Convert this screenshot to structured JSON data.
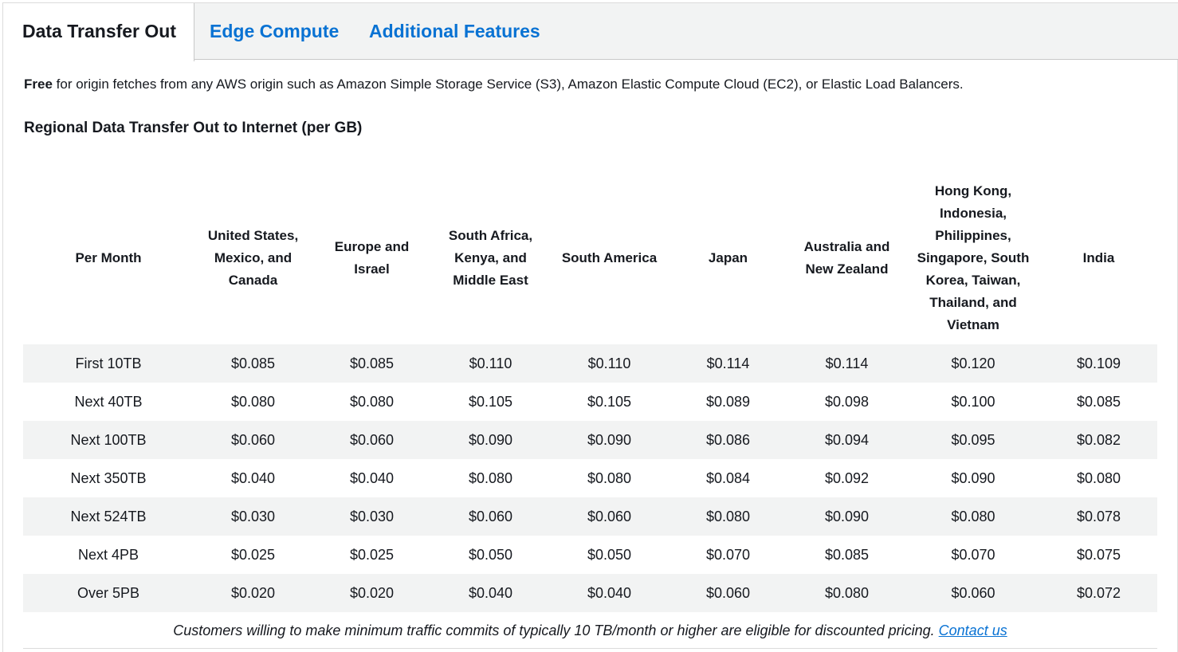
{
  "tabs": [
    {
      "label": "Data Transfer Out",
      "active": true
    },
    {
      "label": "Edge Compute",
      "active": false
    },
    {
      "label": "Additional Features",
      "active": false
    }
  ],
  "intro": {
    "bold": "Free",
    "text": " for origin fetches from any AWS origin such as Amazon Simple Storage Service (S3), Amazon Elastic Compute Cloud (EC2), or Elastic Load Balancers."
  },
  "section_title": "Regional Data Transfer Out to Internet (per GB)",
  "table": {
    "headers": [
      "Per Month",
      "United States, Mexico, and Canada",
      "Europe and Israel",
      "South Africa, Kenya, and Middle East",
      "South America",
      "Japan",
      "Australia and New Zealand",
      "Hong Kong, Indonesia, Philippines, Singapore, South Korea, Taiwan, Thailand, and Vietnam",
      "India"
    ],
    "rows": [
      [
        "First 10TB",
        "$0.085",
        "$0.085",
        "$0.110",
        "$0.110",
        "$0.114",
        "$0.114",
        "$0.120",
        "$0.109"
      ],
      [
        "Next 40TB",
        "$0.080",
        "$0.080",
        "$0.105",
        "$0.105",
        "$0.089",
        "$0.098",
        "$0.100",
        "$0.085"
      ],
      [
        "Next 100TB",
        "$0.060",
        "$0.060",
        "$0.090",
        "$0.090",
        "$0.086",
        "$0.094",
        "$0.095",
        "$0.082"
      ],
      [
        "Next 350TB",
        "$0.040",
        "$0.040",
        "$0.080",
        "$0.080",
        "$0.084",
        "$0.092",
        "$0.090",
        "$0.080"
      ],
      [
        "Next 524TB",
        "$0.030",
        "$0.030",
        "$0.060",
        "$0.060",
        "$0.080",
        "$0.090",
        "$0.080",
        "$0.078"
      ],
      [
        "Next 4PB",
        "$0.025",
        "$0.025",
        "$0.050",
        "$0.050",
        "$0.070",
        "$0.085",
        "$0.070",
        "$0.075"
      ],
      [
        "Over 5PB",
        "$0.020",
        "$0.020",
        "$0.040",
        "$0.040",
        "$0.060",
        "$0.080",
        "$0.060",
        "$0.072"
      ]
    ]
  },
  "footnote": {
    "text": "Customers willing to make minimum traffic commits of typically 10 TB/month or higher are eligible for discounted pricing. ",
    "link": "Contact us"
  },
  "colors": {
    "link": "#0972d3",
    "text": "#16191f",
    "stripe": "#f2f3f3",
    "tab_bar": "#f2f3f3"
  }
}
